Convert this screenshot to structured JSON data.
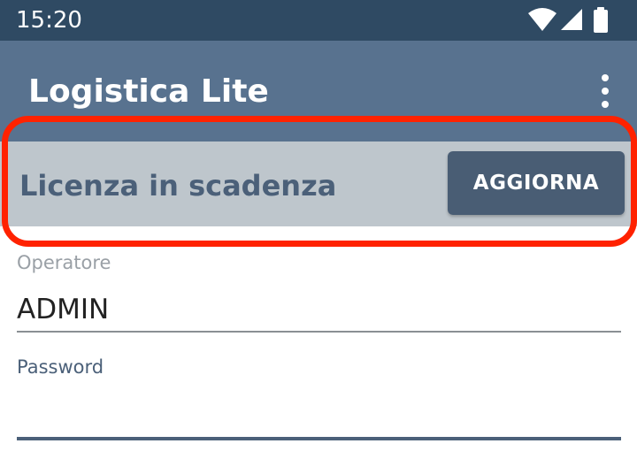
{
  "status_bar": {
    "time": "15:20",
    "icons": [
      "wifi-icon",
      "cellular-signal-icon",
      "battery-icon"
    ]
  },
  "app_bar": {
    "title": "Logistica Lite",
    "menu_icon": "overflow-menu-icon"
  },
  "license_banner": {
    "message": "Licenza in scadenza",
    "button_label": "AGGIORNA"
  },
  "form": {
    "operator": {
      "label": "Operatore",
      "value": "ADMIN"
    },
    "password": {
      "label": "Password",
      "value": ""
    }
  },
  "colors": {
    "status_bar": "#2f4a63",
    "app_bar": "#58728f",
    "banner": "#bec6cc",
    "button": "#495d74",
    "highlight": "#ff2200",
    "accent_text": "#4b6079"
  }
}
